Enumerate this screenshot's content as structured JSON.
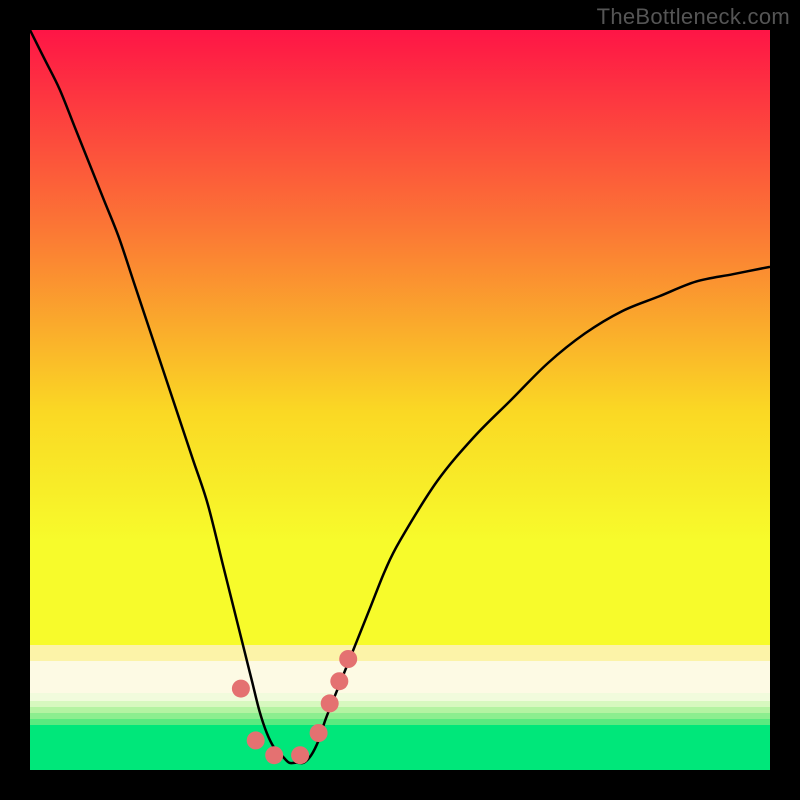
{
  "watermark": "TheBottleneck.com",
  "colors": {
    "gradient_top": "#fe1546",
    "gradient_25": "#fb7635",
    "gradient_50": "#fad824",
    "gradient_75": "#f7fb2b",
    "gradient_bottom_band_top": "#fdf6b7",
    "gradient_green": "#00e77a",
    "curve": "#000000",
    "dots": "#e47171",
    "frame": "#000000"
  },
  "chart_data": {
    "type": "line",
    "title": "",
    "xlabel": "",
    "ylabel": "",
    "xlim": [
      0,
      100
    ],
    "ylim": [
      0,
      100
    ],
    "x": [
      0,
      2,
      4,
      6,
      8,
      10,
      12,
      14,
      16,
      18,
      20,
      22,
      24,
      26,
      27,
      28,
      29,
      30,
      31,
      32,
      33,
      34,
      35,
      36,
      37,
      38,
      39,
      40,
      42,
      44,
      46,
      48,
      50,
      55,
      60,
      65,
      70,
      75,
      80,
      85,
      90,
      95,
      100
    ],
    "values": [
      100,
      96,
      92,
      87,
      82,
      77,
      72,
      66,
      60,
      54,
      48,
      42,
      36,
      28,
      24,
      20,
      16,
      12,
      8,
      5,
      3,
      2,
      1,
      1,
      1,
      2,
      4,
      7,
      12,
      17,
      22,
      27,
      31,
      39,
      45,
      50,
      55,
      59,
      62,
      64,
      66,
      67,
      68
    ],
    "marker_points": [
      {
        "x": 28.5,
        "y": 11
      },
      {
        "x": 30.5,
        "y": 4
      },
      {
        "x": 33.0,
        "y": 2
      },
      {
        "x": 36.5,
        "y": 2
      },
      {
        "x": 39.0,
        "y": 5
      },
      {
        "x": 40.5,
        "y": 9
      },
      {
        "x": 41.8,
        "y": 12
      },
      {
        "x": 43.0,
        "y": 15
      }
    ]
  }
}
